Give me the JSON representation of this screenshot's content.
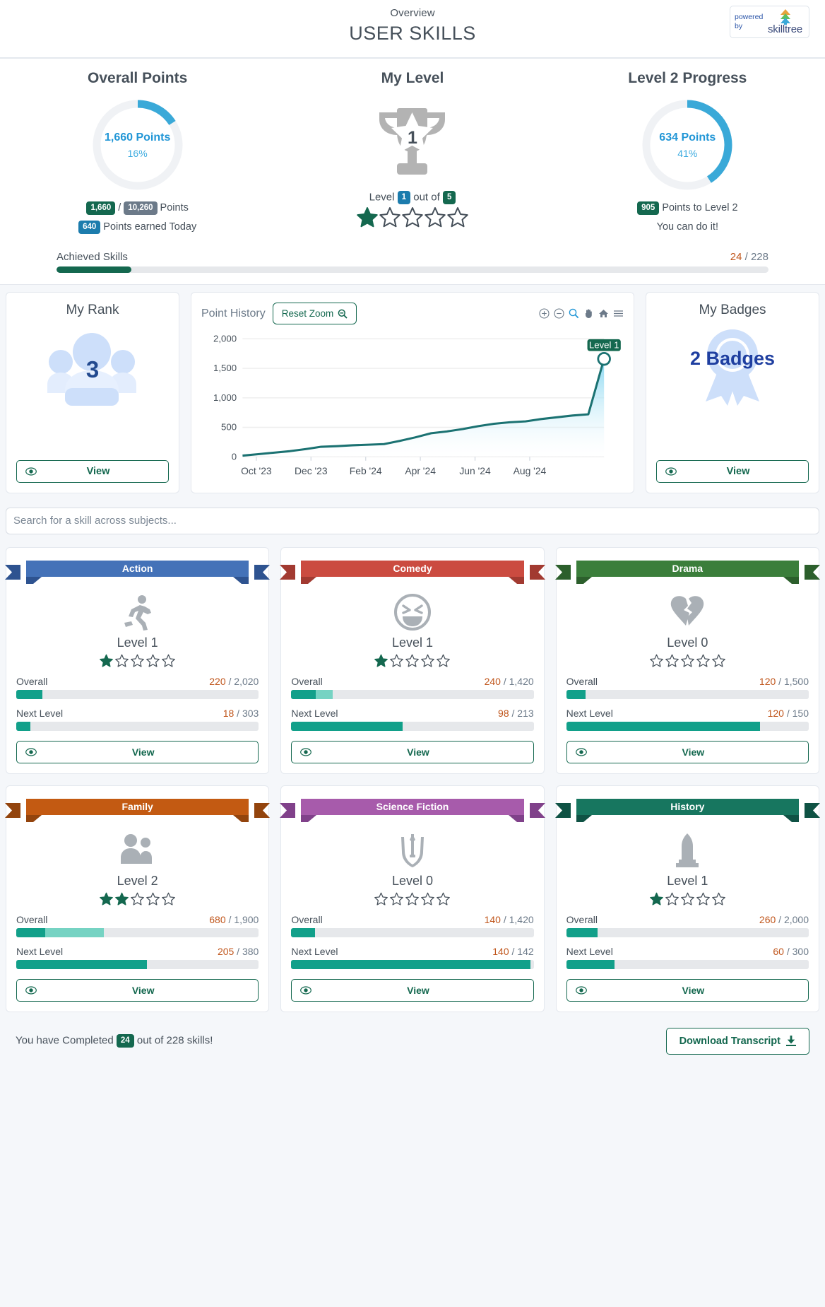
{
  "header": {
    "subtitle": "Overview",
    "title": "USER SKILLS",
    "brand_word1": "powered",
    "brand_word2": "by",
    "brand_name": "skilltree"
  },
  "overall_points": {
    "title": "Overall Points",
    "donut_value": "1,660 Points",
    "donut_pct": "16%",
    "pct_number": 16,
    "earned_badge": "1,660",
    "total_badge": "10,260",
    "points_word": "Points",
    "today_badge": "640",
    "today_label": "Points earned Today"
  },
  "my_level": {
    "title": "My Level",
    "trophy_number": "1",
    "level_prefix": "Level",
    "level_badge": "1",
    "out_of_text": "out of",
    "total_badge": "5",
    "stars_filled": 1,
    "stars_total": 5
  },
  "level_progress": {
    "title": "Level 2 Progress",
    "donut_value": "634 Points",
    "donut_pct": "41%",
    "pct_number": 41,
    "remaining_badge": "905",
    "remaining_label": "Points to Level 2",
    "encouragement": "You can do it!"
  },
  "achieved_skills": {
    "label": "Achieved Skills",
    "value": "24",
    "separator": "/",
    "total": "228",
    "pct_number": 10.5
  },
  "my_rank": {
    "title": "My Rank",
    "rank": "3",
    "view_label": "View",
    "eye_icon": "eye-icon"
  },
  "point_history": {
    "title": "Point History",
    "reset_zoom_label": "Reset Zoom",
    "reset_zoom_icon": "zoom-out-magnifier-icon",
    "tools": [
      {
        "name": "zoom-in-icon",
        "glyph": "⊕"
      },
      {
        "name": "zoom-out-icon",
        "glyph": "⊖"
      },
      {
        "name": "selection-zoom-icon",
        "glyph": "⚲"
      },
      {
        "name": "panning-icon",
        "glyph": "✋"
      },
      {
        "name": "home-reset-icon",
        "glyph": "⌂"
      },
      {
        "name": "menu-icon",
        "glyph": "☰"
      }
    ],
    "tooltip_label": "Level 1"
  },
  "chart_data": {
    "type": "area",
    "title": "Point History",
    "xlabel": "",
    "ylabel": "",
    "ylim": [
      0,
      2000
    ],
    "yticks": [
      "0",
      "500",
      "1,000",
      "1,500",
      "2,000"
    ],
    "xticks": [
      "Oct '23",
      "Dec '23",
      "Feb '24",
      "Apr '24",
      "Jun '24",
      "Aug '24"
    ],
    "grid": true,
    "legend": "none",
    "line_color": "#1b7272",
    "fill_top_color": "#7fd4f0",
    "annotation": "Level 1",
    "x": [
      "Oct '23",
      "Oct '23",
      "Nov '23",
      "Nov '23",
      "Dec '23",
      "Dec '23",
      "Jan '24",
      "Jan '24",
      "Feb '24",
      "Feb '24",
      "Mar '24",
      "Mar '24",
      "Apr '24",
      "Apr '24",
      "May '24",
      "May '24",
      "Jun '24",
      "Jun '24",
      "Jul '24",
      "Jul '24",
      "Aug '24",
      "Aug '24",
      "Sep '24",
      "Sep '24"
    ],
    "values": [
      20,
      45,
      70,
      95,
      130,
      170,
      180,
      195,
      205,
      215,
      270,
      330,
      400,
      430,
      470,
      520,
      560,
      585,
      600,
      640,
      670,
      700,
      720,
      1660
    ],
    "final_point_value": 1660
  },
  "my_badges": {
    "title": "My Badges",
    "count_label": "2 Badges",
    "view_label": "View",
    "eye_icon": "eye-icon"
  },
  "search": {
    "placeholder": "Search for a skill across subjects...",
    "value": ""
  },
  "tiles": [
    {
      "name": "Action",
      "color": "#4472b8",
      "dark": "#2e5390",
      "icon": "running-person-icon",
      "level": "Level 1",
      "stars_filled": 1,
      "overall_label": "Overall",
      "overall_value": "220",
      "overall_total": "2,020",
      "overall_pct": 10.9,
      "overall_pct2": 0,
      "next_label": "Next Level",
      "next_value": "18",
      "next_total": "303",
      "next_pct": 5.9,
      "view_label": "View"
    },
    {
      "name": "Comedy",
      "color": "#cb4b40",
      "dark": "#a23a31",
      "icon": "laughing-face-icon",
      "level": "Level 1",
      "stars_filled": 1,
      "overall_label": "Overall",
      "overall_value": "240",
      "overall_total": "1,420",
      "overall_pct": 10.0,
      "overall_pct2": 7.0,
      "next_label": "Next Level",
      "next_value": "98",
      "next_total": "213",
      "next_pct": 46.0,
      "view_label": "View"
    },
    {
      "name": "Drama",
      "color": "#3b7e3b",
      "dark": "#2c5f2c",
      "icon": "broken-heart-icon",
      "level": "Level 0",
      "stars_filled": 0,
      "overall_label": "Overall",
      "overall_value": "120",
      "overall_total": "1,500",
      "overall_pct": 8.0,
      "overall_pct2": 0,
      "next_label": "Next Level",
      "next_value": "120",
      "next_total": "150",
      "next_pct": 80.0,
      "view_label": "View"
    },
    {
      "name": "Family",
      "color": "#c35a12",
      "dark": "#93440d",
      "icon": "family-people-icon",
      "level": "Level 2",
      "stars_filled": 2,
      "overall_label": "Overall",
      "overall_value": "680",
      "overall_total": "1,900",
      "overall_pct": 12.0,
      "overall_pct2": 24.0,
      "next_label": "Next Level",
      "next_value": "205",
      "next_total": "380",
      "next_pct": 54.0,
      "view_label": "View"
    },
    {
      "name": "Science Fiction",
      "color": "#a75bab",
      "dark": "#80418a",
      "icon": "jedi-order-icon",
      "level": "Level 0",
      "stars_filled": 0,
      "overall_label": "Overall",
      "overall_value": "140",
      "overall_total": "1,420",
      "overall_pct": 9.8,
      "overall_pct2": 0,
      "next_label": "Next Level",
      "next_value": "140",
      "next_total": "142",
      "next_pct": 98.6,
      "view_label": "View"
    },
    {
      "name": "History",
      "color": "#17765f",
      "dark": "#0f5244",
      "icon": "monument-icon",
      "level": "Level 1",
      "stars_filled": 1,
      "overall_label": "Overall",
      "overall_value": "260",
      "overall_total": "2,000",
      "overall_pct": 13.0,
      "overall_pct2": 0,
      "next_label": "Next Level",
      "next_value": "60",
      "next_total": "300",
      "next_pct": 20.0,
      "view_label": "View"
    }
  ],
  "footer": {
    "text_before": "You have Completed",
    "completed_badge": "24",
    "text_after": "out of 228 skills!",
    "download_label": "Download Transcript",
    "download_icon": "download-icon"
  }
}
